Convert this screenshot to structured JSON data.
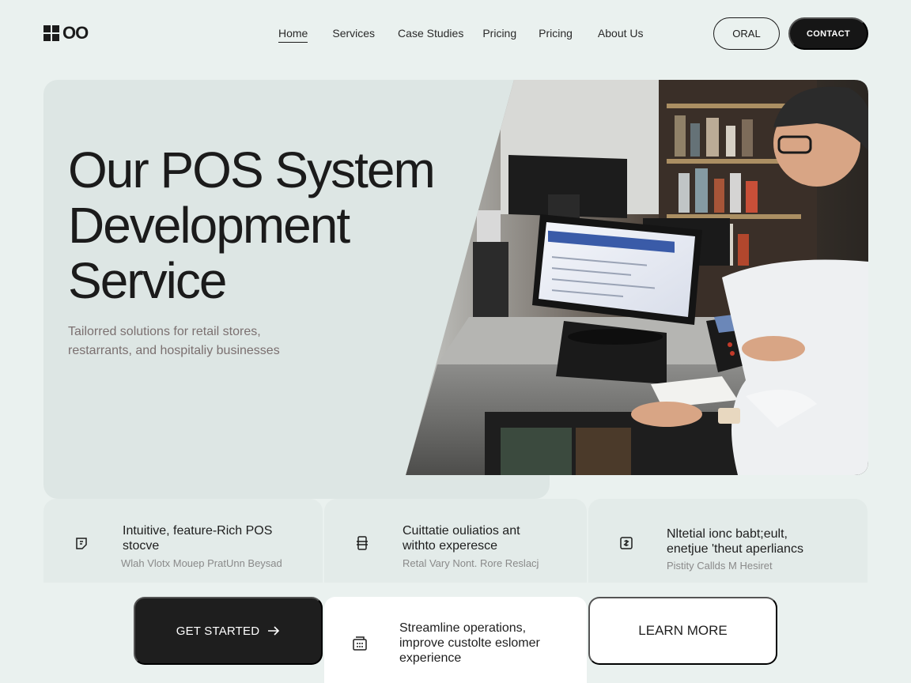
{
  "brand": {
    "logo_text": "OO",
    "logo_icon": "grid-logo-icon"
  },
  "nav": {
    "items": [
      {
        "label": "Home",
        "active": true
      },
      {
        "label": "Services"
      },
      {
        "label": "Case Studies"
      },
      {
        "label": "Pricing"
      },
      {
        "label": "Pricing"
      },
      {
        "label": "About Us"
      }
    ]
  },
  "header": {
    "outline_button": "ORAL",
    "contact_button": "CONTACT"
  },
  "hero": {
    "title_lines": [
      "Our POS System",
      "Development",
      "Service"
    ],
    "subtitle_lines": [
      "Tailorred solutions for retail stores,",
      "restarrants, and hospitaliy businesses"
    ],
    "photo_icon": "pos-checkout-photo"
  },
  "features": [
    {
      "icon": "pos-icon",
      "title_lines": [
        "Intuitive, feature-Rich POS",
        "stocve"
      ],
      "desc": "Wlah Vlotx  Mouep PratUnn  Beysad"
    },
    {
      "icon": "terminal-icon",
      "title_lines": [
        "Cuittatie ouliatios ant",
        "withto experesce"
      ],
      "desc": "Retal Vary Nont. Rore Reslacj"
    },
    {
      "icon": "currency-icon",
      "title_lines": [
        "Nltetial ionc babt;eult,",
        "enetjue 'theut aperliancs"
      ],
      "desc": "Pistity Callds M Hesiret"
    }
  ],
  "cta": {
    "get_started": "GET STARTED",
    "get_started_icon": "arrow-right-icon",
    "stream_icon": "register-icon",
    "stream_lines": [
      "Streamline operations,",
      "improve custolte eslomer",
      "experience"
    ],
    "learn_more": "LEARN MORE"
  },
  "colors": {
    "background": "#eaf1ef",
    "hero_card": "#dde6e4",
    "dark": "#161616",
    "subtitle": "#7b7070"
  }
}
